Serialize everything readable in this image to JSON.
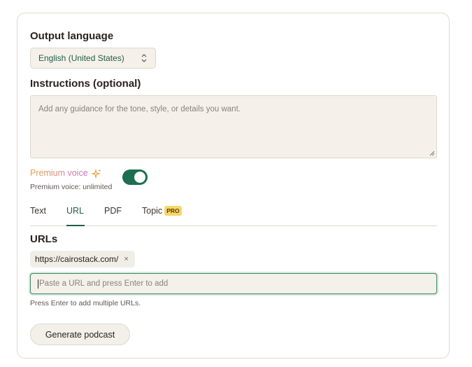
{
  "output_language": {
    "title": "Output language",
    "selected": "English (United States)"
  },
  "instructions": {
    "title": "Instructions (optional)",
    "placeholder": "Add any guidance for the tone, style, or details you want."
  },
  "premium": {
    "label": "Premium voice",
    "sublabel": "Premium voice: unlimited",
    "enabled": true
  },
  "tabs": [
    {
      "label": "Text",
      "active": false
    },
    {
      "label": "URL",
      "active": true
    },
    {
      "label": "PDF",
      "active": false
    },
    {
      "label": "Topic",
      "active": false,
      "badge": "PRO"
    }
  ],
  "urls": {
    "title": "URLs",
    "chips": [
      {
        "label": "https://cairostack.com/",
        "remove": "×"
      }
    ],
    "placeholder": "Paste a URL and press Enter to add",
    "hint": "Press Enter to add multiple URLs."
  },
  "generate_button": "Generate podcast",
  "colors": {
    "accent": "#1f5c4a",
    "toggle_on": "#1e6e52",
    "input_bg": "#f5f1ea",
    "pro_badge": "#f7d66a"
  },
  "icons": {
    "select_chevron": "chevron-up-down-icon",
    "sparkle": "sparkle-icon",
    "chip_remove": "close-icon"
  }
}
